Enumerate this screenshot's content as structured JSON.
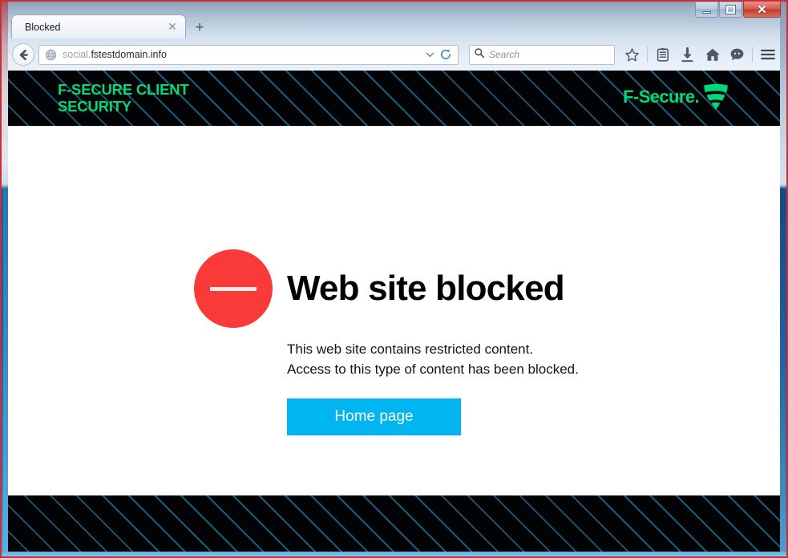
{
  "window": {
    "controls": {
      "minimize_label": "–",
      "maximize_label": "□",
      "close_label": "✕"
    }
  },
  "browser": {
    "tab": {
      "title": "Blocked",
      "close_label": "✕"
    },
    "new_tab_label": "+",
    "back_label": "←",
    "url": {
      "prefix": "social.",
      "domain": "fstestdomain.info"
    },
    "urlbar_dropmarker": "▼",
    "reload_label": "⟳",
    "search": {
      "placeholder": "Search"
    },
    "toolbar_icons": [
      {
        "name": "bookmark-star-icon",
        "label": "☆"
      },
      {
        "name": "reader-list-icon",
        "label": "὜b"
      },
      {
        "name": "downloads-icon",
        "label": "⬇"
      },
      {
        "name": "home-icon",
        "label": "⌂"
      },
      {
        "name": "feedback-chat-icon",
        "label": "Ὂc"
      },
      {
        "name": "app-menu-icon",
        "label": "☰"
      }
    ]
  },
  "page": {
    "header": {
      "product_name": "F-SECURE CLIENT\nSECURITY",
      "brand_name": "F-Secure.",
      "brand_color": "#00d87c",
      "background_color": "#010305"
    },
    "blocked": {
      "icon_name": "blocked-circle-icon",
      "icon_color": "#f93a39",
      "title": "Web site blocked",
      "message": "This web site contains restricted content.\nAccess to this type of content has been blocked.",
      "button_label": "Home page",
      "button_color": "#00b5f0"
    }
  }
}
